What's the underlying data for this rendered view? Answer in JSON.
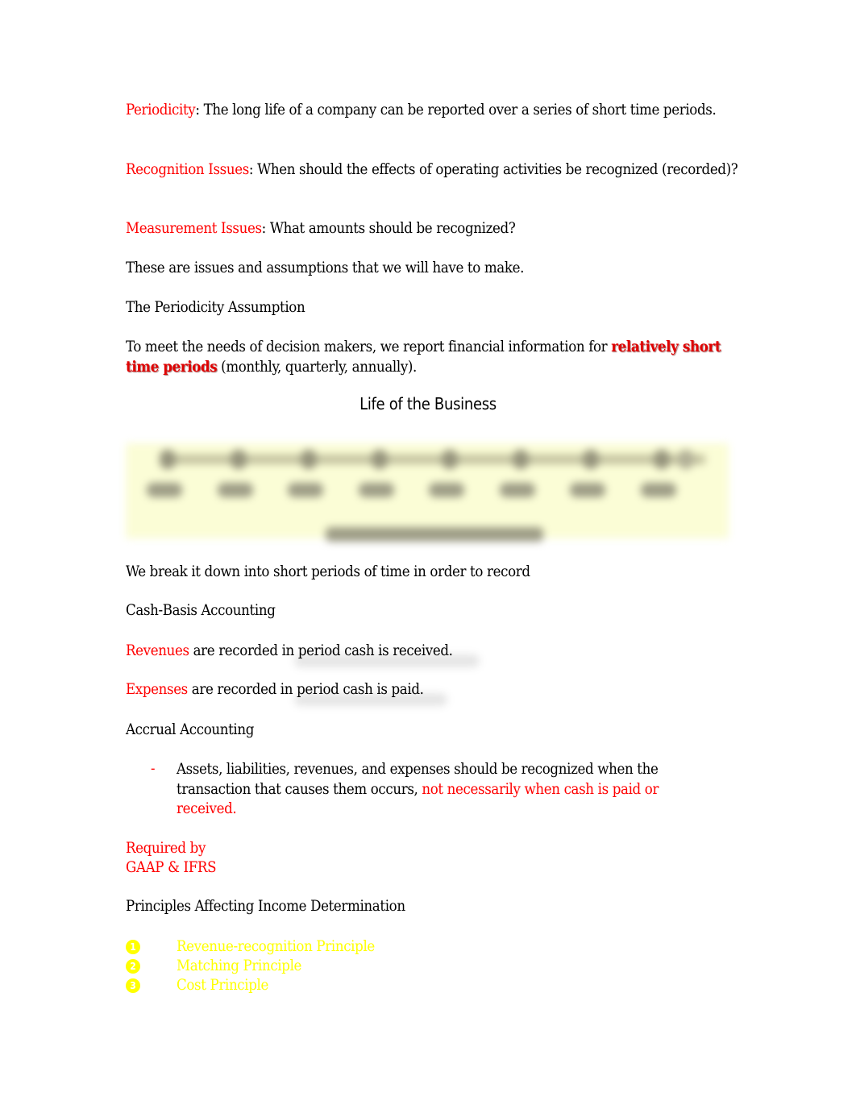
{
  "colors": {
    "accent_red": "#ff0000",
    "highlight_yellow": "#ffff00",
    "figure_background": "#fbfdd6"
  },
  "intro": {
    "periodicity": {
      "term": "Periodicity",
      "rest": ": The long life of a company can be reported over a series of short time periods."
    },
    "recognition": {
      "term": "Recognition Issues",
      "rest": ": When should the effects of operating activities be recognized (recorded)?"
    },
    "measurement": {
      "term": "Measurement Issues",
      "rest": ": What amounts should be recognized?"
    },
    "issues_note": "These are issues and assumptions that we will have to make."
  },
  "periodicity_assumption": {
    "heading": "The Periodicity Assumption",
    "text_before": "To meet the needs of decision makers, we report financial information for ",
    "emphasis": "relatively short time periods",
    "text_after": " (monthly, quarterly, annually)."
  },
  "figure": {
    "title": "Life of the Business",
    "tick_count": 8,
    "blurred": true
  },
  "breakdown_note": "We break it down into short periods of time in order to record",
  "cash_basis": {
    "heading": "Cash-Basis Accounting",
    "revenues": {
      "term": "Revenues",
      "rest": " are recorded in period cash is received."
    },
    "expenses": {
      "term": "Expenses",
      "rest": " are recorded in period cash is paid."
    }
  },
  "accrual": {
    "heading": "Accrual Accounting",
    "bullet_marker": "-",
    "bullet_text": "Assets, liabilities, revenues, and expenses should be recognized when the transaction that causes them occurs, ",
    "bullet_emphasis": "not necessarily when cash is paid or received.",
    "required_line1": "Required by",
    "required_line2": "GAAP & IFRS"
  },
  "principles": {
    "heading": "Principles Affecting Income Determination",
    "items": [
      {
        "number": "1",
        "label": "Revenue-recognition Principle"
      },
      {
        "number": "2",
        "label": "Matching Principle"
      },
      {
        "number": "3",
        "label": "Cost Principle"
      }
    ]
  }
}
